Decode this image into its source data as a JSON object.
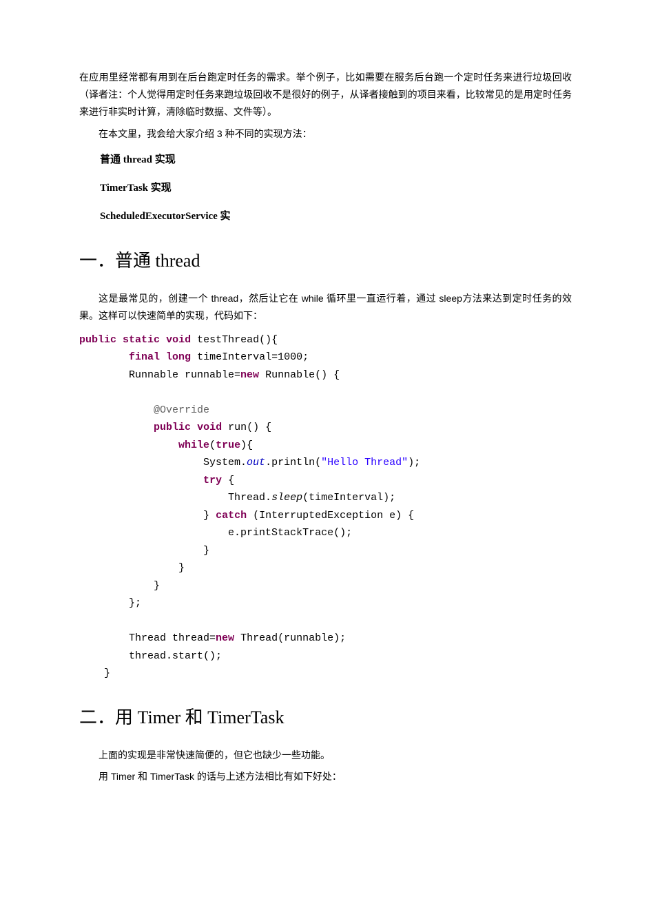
{
  "intro": {
    "p1": "在应用里经常都有用到在后台跑定时任务的需求。举个例子，比如需要在服务后台跑一个定时任务来进行垃圾回收（译者注：个人觉得用定时任务来跑垃圾回收不是很好的例子，从译者接触到的项目来看，比较常见的是用定时任务来进行非实时计算，清除临时数据、文件等）。",
    "p2": "在本文里，我会给大家介绍 3 种不同的实现方法："
  },
  "methods": {
    "m1": "普通 thread 实现",
    "m2": "TimerTask 实现",
    "m3": "ScheduledExecutorService 实"
  },
  "section1": {
    "heading": "一．普通 thread",
    "para": "这是最常见的，创建一个 thread，然后让它在 while 循环里一直运行着，通过 sleep方法来达到定时任务的效果。这样可以快速简单的实现，代码如下："
  },
  "code1": {
    "kw_public": "public",
    "kw_static": "static",
    "kw_void": "void",
    "fn_testThread": "testThread(){",
    "kw_final": "final",
    "kw_long": "long",
    "var_time": "timeInterval=1000;",
    "runnable_decl": "Runnable runnable=",
    "kw_new": "new",
    "runnable_ctor": "Runnable() {",
    "ann_override": "@Override",
    "run_sig": "run() {",
    "kw_while": "while",
    "kw_true": "true",
    "while_close": "){",
    "sysout_pre": "System.",
    "sysout_out": "out",
    "sysout_mid": ".println(",
    "str_hello": "\"Hello Thread\"",
    "sysout_end": ");",
    "kw_try": "try",
    "try_open": "{",
    "thread_pre": "Thread.",
    "sleep_call": "sleep",
    "sleep_arg": "(timeInterval);",
    "close_brace": "}",
    "kw_catch": "catch",
    "catch_arg": "(InterruptedException e) {",
    "stacktrace": "e.printStackTrace();",
    "anon_close": "};",
    "thread_decl": "Thread thread=",
    "thread_ctor": "Thread(runnable);",
    "thread_start": "thread.start();"
  },
  "section2": {
    "heading": "二．用 Timer 和 TimerTask",
    "p1": "上面的实现是非常快速简便的，但它也缺少一些功能。",
    "p2": "用 Timer 和 TimerTask 的话与上述方法相比有如下好处："
  }
}
